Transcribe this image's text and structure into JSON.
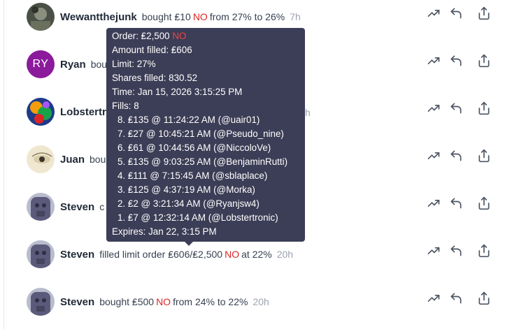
{
  "feed": [
    {
      "user": "Wewantthejunk",
      "desc_pre": "bought ₤10",
      "outcome": "NO",
      "desc_post": "from 27% to 26%",
      "time": "7h",
      "avatar": "photo-dark"
    },
    {
      "user": "Ryan",
      "desc_pre": "bou",
      "outcome": "",
      "desc_post": "",
      "time": "",
      "avatar": "initials",
      "initials": "RY"
    },
    {
      "user": "Lobstertr",
      "desc_pre": "",
      "outcome": "",
      "desc_post": "",
      "time": "h",
      "avatar": "colorful"
    },
    {
      "user": "Juan",
      "desc_pre": "bou",
      "outcome": "",
      "desc_post": "",
      "time": "",
      "avatar": "eye"
    },
    {
      "user": "Steven",
      "desc_pre": "c",
      "outcome": "",
      "desc_post": "",
      "time": "",
      "avatar": "statue"
    },
    {
      "user": "Steven",
      "desc_pre": "filled limit order ₤606/₤2,500",
      "outcome": "NO",
      "desc_post": "at 22%",
      "time": "20h",
      "avatar": "statue"
    },
    {
      "user": "Steven",
      "desc_pre": "bought ₤500",
      "outcome": "NO",
      "desc_post": "from 24% to 22%",
      "time": "20h",
      "avatar": "statue"
    }
  ],
  "actions": [
    {
      "icon": "trending-up-icon",
      "label": "view-trend"
    },
    {
      "icon": "reply-icon",
      "label": "reply"
    },
    {
      "icon": "share-icon",
      "label": "share"
    }
  ],
  "tooltip": {
    "order_label": "Order: ₤2,500",
    "order_outcome": "NO",
    "amount_filled": "Amount filled: ₤606",
    "limit": "Limit: 27%",
    "shares_filled": "Shares filled: 830.52",
    "time": "Time: Jan 15, 2026 3:15:25 PM",
    "fills_label": "Fills: 8",
    "fills": [
      "8. ₤135 @ 11:24:22 AM (@uair01)",
      "7. ₤27 @ 10:45:21 AM (@Pseudo_nine)",
      "6. ₤61 @ 10:44:56 AM (@NiccoloVe)",
      "5. ₤135 @ 9:03:25 AM (@BenjaminRutti)",
      "4. ₤111 @ 7:15:45 AM (@sblaplace)",
      "3. ₤125 @ 4:37:19 AM (@Morka)",
      "2. ₤2 @ 3:21:34 AM (@Ryanjsw4)",
      "1. ₤7 @ 12:32:14 AM (@Lobstertronic)"
    ],
    "expires": "Expires: Jan 22, 3:15 PM"
  }
}
